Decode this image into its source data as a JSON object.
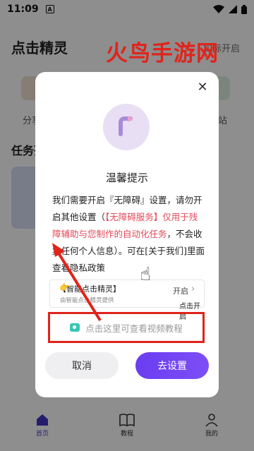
{
  "status_bar": {
    "time": "11:09",
    "notification_icon": "A"
  },
  "app": {
    "title": "点击精灵",
    "header_right": "实际开启"
  },
  "background": {
    "label_left": "分享",
    "label_right": "站",
    "section_title": "任务列"
  },
  "watermark": "火鸟手游网",
  "dialog": {
    "title": "温馨提示",
    "body_part1": "我们需要开启『无障碍』设置，请勿开启其他设置（",
    "body_highlight": "【无障碍服务】仅用于残障辅助与您制作的自动化任务",
    "body_part2": "，不会收集任何个人信息）。可在[关于我们]里面查看隐私政策",
    "tutorial": {
      "title": "【智能点击精灵】",
      "subtitle": "由智能点击精灵提供",
      "switch_label": "开启",
      "click_open": "点击开启"
    },
    "video_link": "点击这里可查看视频教程",
    "cancel_label": "取消",
    "confirm_label": "去设置"
  },
  "bottom_nav": [
    {
      "label": "首页",
      "icon": "home-icon"
    },
    {
      "label": "教程",
      "icon": "book-icon"
    },
    {
      "label": "我的",
      "icon": "user-icon"
    }
  ],
  "colors": {
    "accent": "#6a3df0",
    "highlight": "#e04a59",
    "annotation_red": "#e0241b"
  }
}
